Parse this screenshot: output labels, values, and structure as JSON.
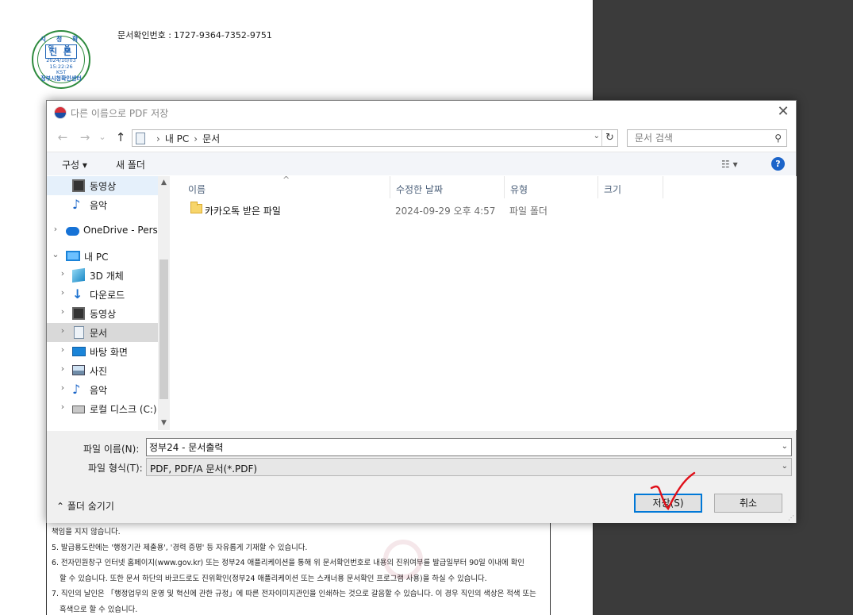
{
  "document": {
    "seal": {
      "top_text": "시 청 확 인 용",
      "main_text": "진 본",
      "date": "2024/10/03",
      "time": "15:22:26",
      "tz": "KST",
      "bottom_text": "정부시청확인센터",
      "color": "#1e63b5",
      "ring_color": "#2e8b3e"
    },
    "doc_number_label": "문서확인번호 :",
    "doc_number_value": "1727-9364-7352-9751",
    "notes": [
      "책임을 지지 않습니다.",
      "5. 발급용도란에는 '행정기관 제출용', '경력 증명' 등 자유롭게 기재할 수 있습니다.",
      "6. 전자민원창구 인터넷 홈페이지(www.gov.kr) 또는 정부24 애플리케이션을 통해 위 문서확인번호로 내용의 진위여부를 발급일부터 90일 이내에 확인",
      "할 수 있습니다. 또한 문서 하단의 바코드로도 진위확인(정부24 애플리케이션 또는 스캐너용 문서확인 프로그램 사용)을 하실 수 있습니다.",
      "7. 직인의 날인은 「행정업무의 운영 및 혁신에 관한 규정」에 따른 전자이미지관인을 인쇄하는 것으로 갈음할 수 있습니다. 이 경우 직인의 색상은 적색 또는",
      "흑색으로 할 수 있습니다."
    ]
  },
  "dialog": {
    "title": "다른 이름으로 PDF 저장",
    "close_glyph": "✕",
    "nav": {
      "back": "←",
      "forward": "→",
      "recent": "⌄",
      "up": "↑"
    },
    "address": {
      "crumbs": [
        "내 PC",
        "문서"
      ],
      "sep": "›",
      "dropdown": "⌄",
      "refresh": "↻"
    },
    "search": {
      "placeholder": "문서 검색",
      "icon": "⚲"
    },
    "toolbar": {
      "organize": "구성 ▾",
      "new_folder": "새 폴더",
      "view": "☷ ▾",
      "help": "?"
    },
    "nav_pane": {
      "items": [
        {
          "label": "동영상",
          "icon": "video-icon",
          "expand": ""
        },
        {
          "label": "음악",
          "icon": "music-icon",
          "expand": ""
        },
        {
          "label": "OneDrive - Person",
          "icon": "onedrive-icon",
          "expand": "›"
        },
        {
          "label": "내 PC",
          "icon": "pc-icon",
          "expand": "⌄"
        },
        {
          "label": "3D 개체",
          "icon": "3d-objects-icon",
          "expand": "›"
        },
        {
          "label": "다운로드",
          "icon": "download-icon",
          "expand": "›"
        },
        {
          "label": "동영상",
          "icon": "video-icon",
          "expand": "›"
        },
        {
          "label": "문서",
          "icon": "document-icon",
          "expand": "›"
        },
        {
          "label": "바탕 화면",
          "icon": "desktop-icon",
          "expand": "›"
        },
        {
          "label": "사진",
          "icon": "pictures-icon",
          "expand": "›"
        },
        {
          "label": "음악",
          "icon": "music-icon",
          "expand": "›"
        },
        {
          "label": "로컬 디스크 (C:)",
          "icon": "disk-icon",
          "expand": "›"
        }
      ],
      "scroll_up": "▲",
      "scroll_down": "▼"
    },
    "columns": {
      "name": "이름",
      "modified": "수정한 날짜",
      "type": "유형",
      "size": "크기",
      "sort_caret": "^"
    },
    "files": [
      {
        "name": "카카오톡 받은 파일",
        "modified": "2024-09-29 오후 4:57",
        "type": "파일 폴더",
        "size": ""
      }
    ],
    "filename_label": "파일 이름(N):",
    "filename_value": "정부24 - 문서출력",
    "filetype_label": "파일 형식(T):",
    "filetype_value": "PDF, PDF/A 문서(*.PDF)",
    "dropdown_glyph": "⌄",
    "hide_folders": "⌃ 폴더 숨기기",
    "save_button": "저장(S)",
    "cancel_button": "취소",
    "resize_grip": "⋰",
    "accent": "#0078d7"
  },
  "annotation": {
    "color": "#e0101a"
  }
}
